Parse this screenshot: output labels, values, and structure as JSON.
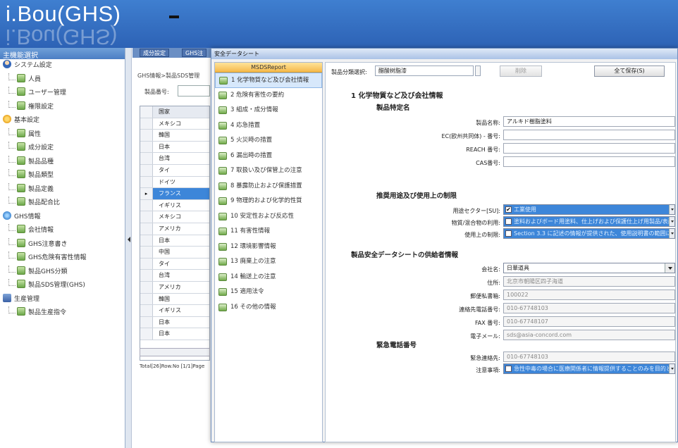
{
  "app": {
    "logo": "i.Bou(GHS)",
    "logo_reflection": "i.Bou(GHS)"
  },
  "nav": {
    "title": "主機能選択",
    "items": [
      {
        "label": "システム設定",
        "level": 0,
        "icon": "person-icon"
      },
      {
        "label": "人員",
        "level": 1,
        "icon": "page-icon"
      },
      {
        "label": "ユーザー管理",
        "level": 1,
        "icon": "page-icon"
      },
      {
        "label": "権限設定",
        "level": 1,
        "icon": "page-icon"
      },
      {
        "label": "基本設定",
        "level": 0,
        "icon": "gear-icon"
      },
      {
        "label": "属性",
        "level": 1,
        "icon": "page-icon"
      },
      {
        "label": "成分設定",
        "level": 1,
        "icon": "page-icon"
      },
      {
        "label": "製品品種",
        "level": 1,
        "icon": "page-icon"
      },
      {
        "label": "製品類型",
        "level": 1,
        "icon": "page-icon"
      },
      {
        "label": "製品定義",
        "level": 1,
        "icon": "page-icon"
      },
      {
        "label": "製品配合比",
        "level": 1,
        "icon": "page-icon"
      },
      {
        "label": "GHS情報",
        "level": 0,
        "icon": "globe-icon"
      },
      {
        "label": "会社情報",
        "level": 1,
        "icon": "page-icon"
      },
      {
        "label": "GHS注意書き",
        "level": 1,
        "icon": "page-icon"
      },
      {
        "label": "GHS危険有害性情報",
        "level": 1,
        "icon": "page-icon"
      },
      {
        "label": "製品GHS分類",
        "level": 1,
        "icon": "page-icon"
      },
      {
        "label": "製品SDS管理(GHS)",
        "level": 1,
        "icon": "page-icon"
      },
      {
        "label": "生産管理",
        "level": 0,
        "icon": "factory-icon"
      },
      {
        "label": "製品生産指令",
        "level": 1,
        "icon": "page-icon"
      }
    ]
  },
  "background": {
    "tabs": [
      "成分設定",
      "GHS注"
    ],
    "breadcrumb": "GHS情報>製品SDS管理",
    "product_no_label": "製品番号:",
    "grid": {
      "header": "国家",
      "rows": [
        "メキシコ",
        "韓国",
        "日本",
        "台湾",
        "タイ",
        "ドイツ",
        "フランス",
        "イギリス",
        "メキシコ",
        "アメリカ",
        "日本",
        "中国",
        "タイ",
        "台湾",
        "アメリカ",
        "韓国",
        "イギリス",
        "日本",
        "日本"
      ],
      "selected_index": 6
    },
    "footer": "Total[26]Row.No [1/1]Page"
  },
  "dialog": {
    "title": "安全データシート",
    "menu": {
      "header": "MSDSReport",
      "items": [
        "1 化学物質など及び会社情報",
        "2 危険有害性の要約",
        "3 組成・成分情報",
        "4 応急措置",
        "5 火災時の措置",
        "6 漏出時の措置",
        "7 取扱い及び保管上の注意",
        "8 暴露防止および保護措置",
        "9 物理的および化学的性質",
        "10 安定性および反応性",
        "11 有害性情報",
        "12 環境影響情報",
        "13 廃棄上の注意",
        "14 輸送上の注意",
        "15 適用法令",
        "16 その他の情報"
      ],
      "active_index": 0
    },
    "toolbar": {
      "category_label": "製品分類選択:",
      "category_value": "醋酸树脂漆",
      "delete_label": "削除",
      "save_all_label": "全て保存(S)"
    },
    "section": {
      "title": "1 化学物質など及び会社情報",
      "product_id_title": "製品特定名",
      "product_name_label": "製品名称:",
      "product_name_value": "アルキド樹脂塗料",
      "ec_label": "EC(欧州共同体) - 番号:",
      "reach_label": "REACH 番号:",
      "cas_label": "CAS番号:",
      "use_title": "推奨用途及び使用上の制限",
      "sector_label": "用途セクター[SU]:",
      "sector_value": "工業使用",
      "mixture_use_label": "物質/混合物の利用:",
      "mixture_use_value": "塗料およびボード用塗料、仕上げおよび保護仕上げ用製品/表面剤および",
      "restriction_label": "使用上の制限:",
      "restriction_value": "Section 3.3 に記述の情報が提供された、使用説明書の範囲に、その用途...",
      "supplier_title": "製品安全データシートの供給者情報",
      "company_label": "会社名:",
      "company_value": "日華道具",
      "address_label": "住所:",
      "address_value": "北京市朝陽区四子海道",
      "postal_label": "郵便私書箱:",
      "postal_value": "100022",
      "phone_label": "連絡先電話番号:",
      "phone_value": "010-67748103",
      "fax_label": "FAX 番号:",
      "fax_value": "010-67748107",
      "email_label": "電子メール:",
      "email_value": "sds@asia-concord.com",
      "emergency_title": "緊急電話番号",
      "emergency_contact_label": "緊急連絡先:",
      "emergency_contact_value": "010-67748103",
      "note_label": "注意事項:",
      "note_value": "急性中毒の場合に医療関係者に情報提供することのみを目的としている"
    }
  },
  "colors": {
    "header_blue": "#2d62b5",
    "selection_blue": "#3d86d9",
    "menu_header_orange": "#f5b94a"
  }
}
